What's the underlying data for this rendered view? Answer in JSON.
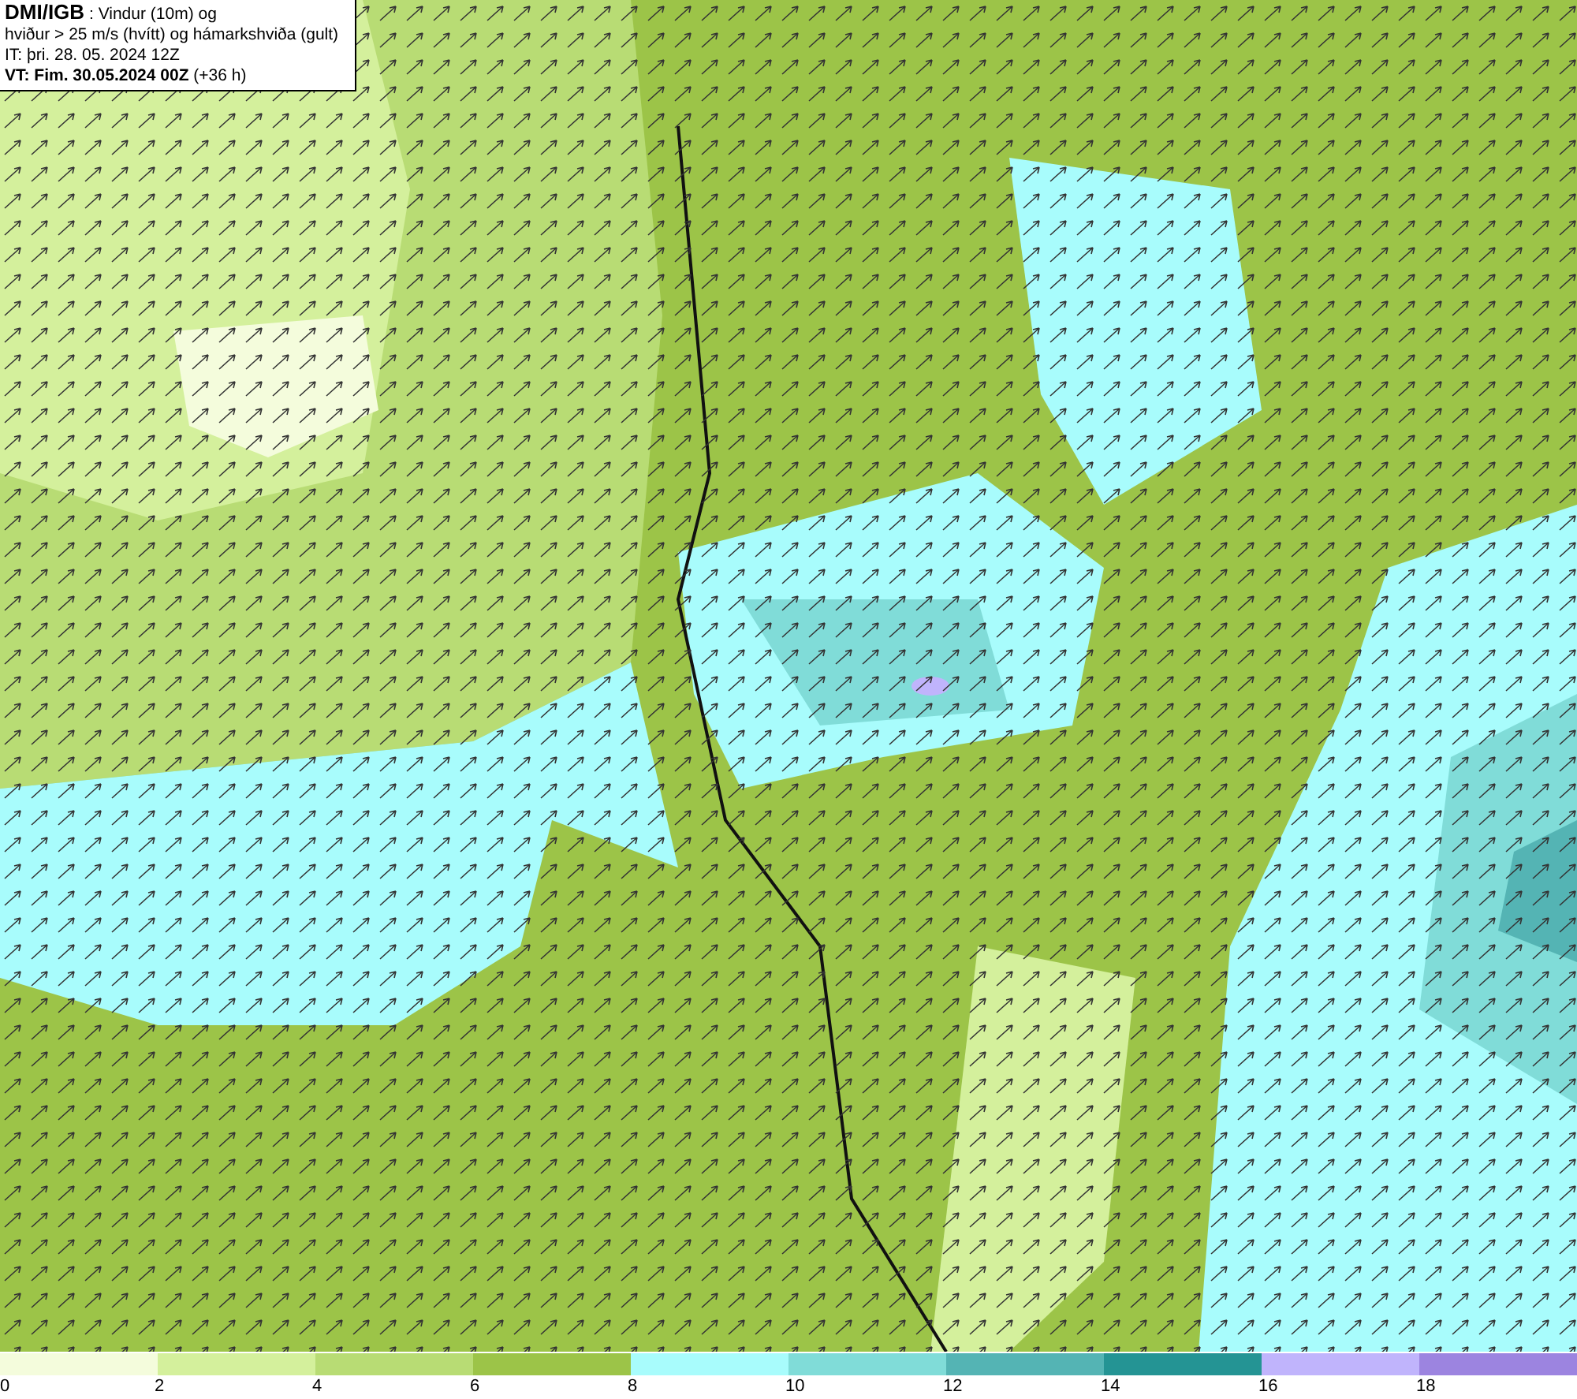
{
  "info_box": {
    "lines": [
      "**DMI/IGB** : Vindur (10m) og",
      "hviður > 25 m/s (hvítt) og hámarkshviða (gult)",
      "IT: þri. 28. 05. 2024 12Z",
      "**VT: Fim. 30.05.2024 00Z** (+36 h)"
    ]
  },
  "colorbar": {
    "bins": [
      {
        "color": "#f4fcdc",
        "label": "0"
      },
      {
        "color": "#d4f09c",
        "label": "2"
      },
      {
        "color": "#b8dc74",
        "label": "4"
      },
      {
        "color": "#9cc448",
        "label": "6"
      },
      {
        "color": "#a8fcfc",
        "label": "8"
      },
      {
        "color": "#80dcd8",
        "label": "10"
      },
      {
        "color": "#54b4b4",
        "label": "12"
      },
      {
        "color": "#249494",
        "label": "14"
      },
      {
        "color": "#c0b4fc",
        "label": "16"
      },
      {
        "color": "#9c84e0",
        "label": "18"
      }
    ]
  }
}
